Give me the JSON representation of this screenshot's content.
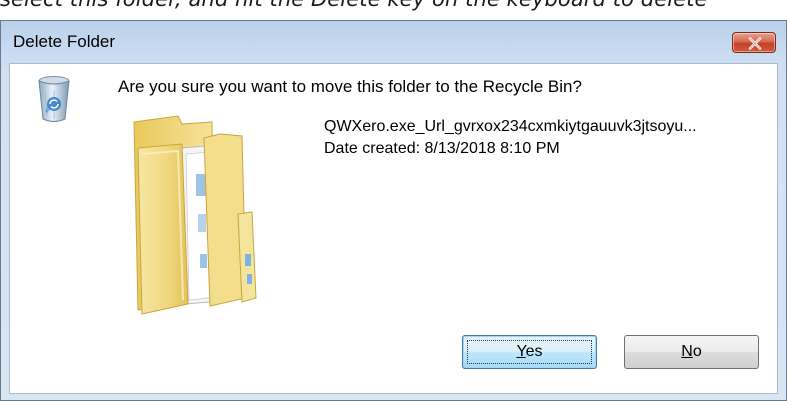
{
  "background": {
    "text": "select this folder, and hit the Delete key on the keyboard to delete"
  },
  "dialog": {
    "title": "Delete Folder",
    "question": "Are you sure you want to move this folder to the Recycle Bin?",
    "item_name": "QWXero.exe_Url_gvrxox234cxmkiytgauuvk3jtsoyu...",
    "item_date": "Date created: 8/13/2018 8:10 PM",
    "yes_label_accel": "Y",
    "yes_label_rest": "es",
    "no_label_accel": "N",
    "no_label_rest": "o",
    "icons": {
      "close": "close-icon",
      "recycle_bin": "recycle-bin-icon",
      "folder": "folder-icon"
    },
    "colors": {
      "close_button": "#c4412a",
      "default_button": "#bee6fd",
      "titlebar": "#b9d1ea"
    }
  }
}
